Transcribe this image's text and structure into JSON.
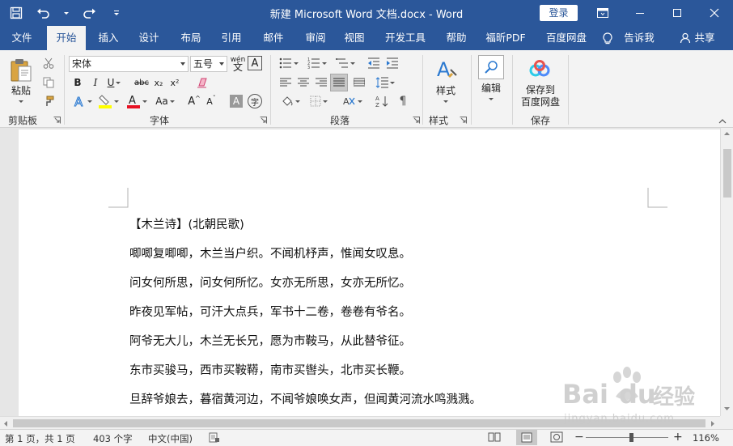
{
  "window": {
    "title": "新建 Microsoft Word 文档.docx  -  Word",
    "login_label": "登录"
  },
  "tabs": [
    "文件",
    "开始",
    "插入",
    "设计",
    "布局",
    "引用",
    "邮件",
    "审阅",
    "视图",
    "开发工具",
    "帮助",
    "福昕PDF",
    "百度网盘"
  ],
  "tell_me": "告诉我",
  "share": "共享",
  "ribbon": {
    "clipboard": {
      "paste": "粘贴",
      "label": "剪贴板"
    },
    "font": {
      "name": "宋体",
      "size": "五号",
      "label": "字体",
      "bold": "B",
      "italic": "I",
      "underline": "U",
      "strike": "abc",
      "sub": "x₂",
      "sup": "x²",
      "case": "Aa",
      "grow": "A",
      "shrink": "A"
    },
    "paragraph": {
      "label": "段落"
    },
    "styles": {
      "button": "样式",
      "label": "样式"
    },
    "editing": {
      "button": "编辑"
    },
    "save": {
      "button_line1": "保存到",
      "button_line2": "百度网盘",
      "label": "保存"
    }
  },
  "document": {
    "lines": [
      "【木兰诗】(北朝民歌)",
      "唧唧复唧唧，木兰当户织。不闻机杼声，惟闻女叹息。",
      "问女何所思，问女何所忆。女亦无所思，女亦无所忆。",
      "昨夜见军帖，可汗大点兵，军书十二卷，卷卷有爷名。",
      "阿爷无大儿，木兰无长兄，愿为市鞍马，从此替爷征。",
      "东市买骏马，西市买鞍鞯，南市买辔头，北市买长鞭。",
      "旦辞爷娘去，暮宿黄河边，不闻爷娘唤女声，但闻黄河流水鸣溅溅。"
    ]
  },
  "status": {
    "page": "第 1 页，共 1 页",
    "words": "403 个字",
    "language": "中文(中国)",
    "zoom": "116%"
  },
  "watermark": {
    "brand": "Bai",
    "brand2": "du",
    "suffix": "经验",
    "url": "jingyan.baidu.com"
  },
  "colors": {
    "accent": "#2b579a",
    "highlight": "#ffff00",
    "font_color": "#e81123",
    "baidu_logo": [
      "#4f8bf9",
      "#2ecbe8",
      "#e8534f"
    ]
  }
}
